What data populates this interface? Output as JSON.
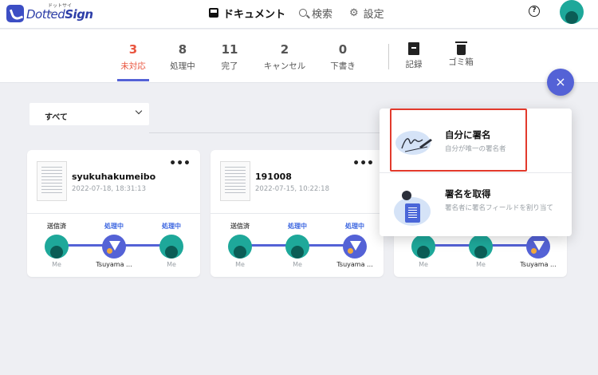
{
  "header": {
    "logo_text_prefix": "Dotted",
    "logo_text_bold": "Sign",
    "logo_kana": "ドットサイン",
    "nav_documents": "ドキュメント",
    "nav_search": "検索",
    "nav_settings": "設定",
    "help_symbol": "?"
  },
  "tabs": [
    {
      "count": "3",
      "label": "未対応",
      "active": true
    },
    {
      "count": "8",
      "label": "処理中"
    },
    {
      "count": "11",
      "label": "完了"
    },
    {
      "count": "2",
      "label": "キャンセル"
    },
    {
      "count": "0",
      "label": "下書き"
    }
  ],
  "tab_tools": [
    {
      "label": "記録",
      "icon": "archive-icon"
    },
    {
      "label": "ゴミ箱",
      "icon": "trash-icon"
    }
  ],
  "fab_symbol": "×",
  "filter": {
    "selected": "すべて"
  },
  "cards": [
    {
      "title": "syukuhakumeibo",
      "date": "2022-07-18, 18:31:13",
      "steps": [
        {
          "status": "送信済",
          "name": "Me"
        },
        {
          "status": "処理中",
          "name": "Tsuyama ..."
        },
        {
          "status": "処理中",
          "name": "Me"
        }
      ]
    },
    {
      "title": "191008",
      "date": "2022-07-15, 10:22:18",
      "steps": [
        {
          "status": "送信済",
          "name": "Me"
        },
        {
          "status": "処理中",
          "name": "Me"
        },
        {
          "status": "処理中",
          "name": "Tsuyama ..."
        }
      ]
    },
    {
      "title": "",
      "date": "",
      "steps": [
        {
          "status": "",
          "name": "Me"
        },
        {
          "status": "",
          "name": "Me"
        },
        {
          "status": "",
          "name": "Tsuyama ..."
        }
      ]
    }
  ],
  "popup": {
    "sign_self": {
      "title": "自分に署名",
      "desc": "自分が唯一の署名者"
    },
    "request": {
      "title": "署名を取得",
      "desc": "署名者に署名フィールドを割り当て"
    }
  },
  "colors": {
    "accent": "#5462d6",
    "active_tab": "#e9553f",
    "highlight": "#e23a2c",
    "avatar_me": "#1ea89a"
  }
}
